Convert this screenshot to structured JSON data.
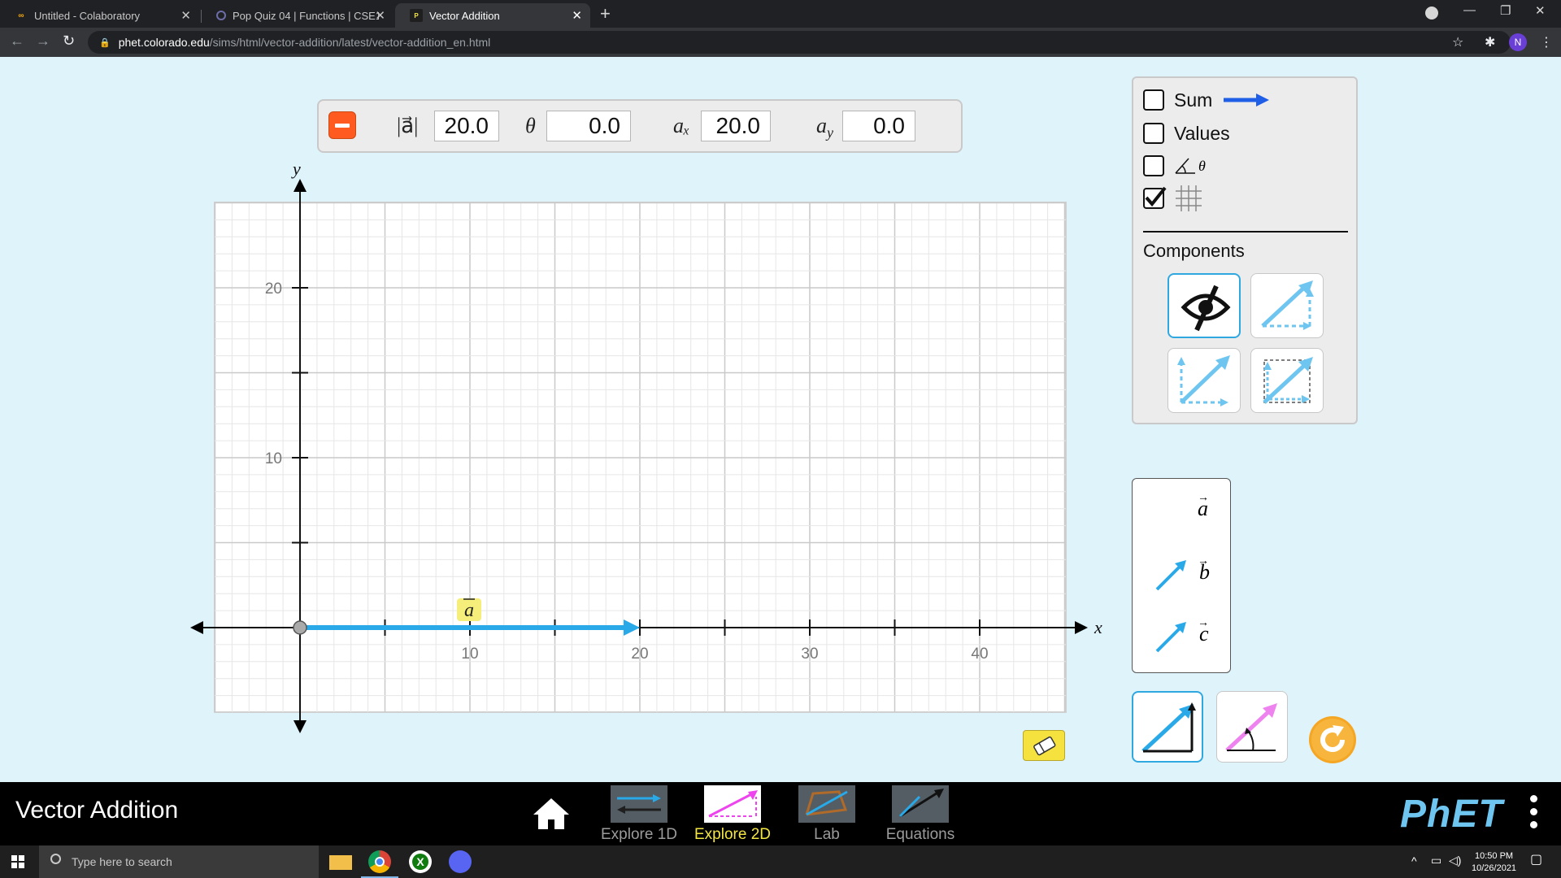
{
  "browser": {
    "tabs": [
      {
        "title": "Untitled - Colaboratory",
        "favicon": "colab-icon"
      },
      {
        "title": "Pop Quiz 04 | Functions | CSE111",
        "favicon": "loading-icon"
      },
      {
        "title": "Vector Addition",
        "favicon": "phet-icon",
        "active": true
      }
    ],
    "url_host": "phet.colorado.edu",
    "url_path": "/sims/html/vector-addition/latest/vector-addition_en.html",
    "profile_initial": "N"
  },
  "vector_panel": {
    "magnitude_label": "|a⃗|",
    "magnitude": "20.0",
    "theta_label": "θ",
    "theta": "0.0",
    "ax_label": "aₓ",
    "ax": "20.0",
    "ay_label": "a",
    "ay_sub": "y",
    "ay": "0.0"
  },
  "graph": {
    "x_axis_label": "x",
    "y_axis_label": "y",
    "x_tick_labels": [
      "10",
      "20",
      "30",
      "40"
    ],
    "y_tick_labels": [
      "10",
      "20"
    ],
    "vector_label": "a",
    "vector_color": "#29a9e8",
    "vector_tail": [
      0,
      0
    ],
    "vector_tip": [
      20,
      0
    ]
  },
  "control_panel": {
    "sum_label": "Sum",
    "sum_checked": false,
    "values_label": "Values",
    "values_checked": false,
    "angle_checked": false,
    "angle_symbol": "θ",
    "grid_checked": true,
    "components_title": "Components",
    "sum_arrow_color": "#1f5fe8"
  },
  "vector_toolbox": {
    "labels": [
      "a",
      "b",
      "c"
    ],
    "arrow_color": "#29a9e8"
  },
  "navbar": {
    "sim_title": "Vector Addition",
    "screens": [
      {
        "label": "Explore 1D",
        "selected": false
      },
      {
        "label": "Explore 2D",
        "selected": true
      },
      {
        "label": "Lab",
        "selected": false
      },
      {
        "label": "Equations",
        "selected": false
      }
    ],
    "brand": "PhET"
  },
  "taskbar": {
    "search_placeholder": "Type here to search",
    "time": "10:50 PM",
    "date": "10/26/2021"
  }
}
